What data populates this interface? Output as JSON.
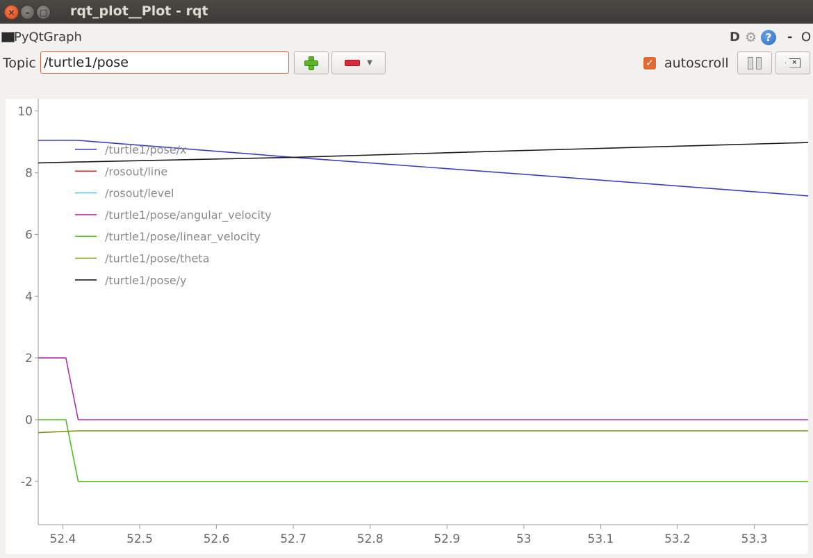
{
  "window": {
    "title": "rqt_plot__Plot - rqt",
    "close_glyph": "×",
    "min_glyph": "–",
    "max_glyph": "□"
  },
  "header": {
    "plugin_label": "PyQtGraph",
    "d_label": "D",
    "help_glyph": "?",
    "dash_label": "-",
    "o_label": "O"
  },
  "toolbar": {
    "topic_label": "Topic",
    "topic_value": "/turtle1/pose",
    "autoscroll_label": "autoscroll",
    "autoscroll_checked": true,
    "check_glyph": "✓",
    "clear_glyph": "×"
  },
  "chart_data": {
    "type": "line",
    "xlim": [
      52.368,
      53.37
    ],
    "ylim": [
      -3.4,
      10.4
    ],
    "x_ticks": [
      52.4,
      52.5,
      52.6,
      52.7,
      52.8,
      52.9,
      53,
      53.1,
      53.2,
      53.3
    ],
    "x_tick_labels": [
      "52.4",
      "52.5",
      "52.6",
      "52.7",
      "52.8",
      "52.9",
      "53",
      "53.1",
      "53.2",
      "53.3"
    ],
    "y_ticks": [
      10,
      8,
      6,
      4,
      2,
      0,
      -2
    ],
    "y_tick_labels": [
      "10",
      "8",
      "6",
      "4",
      "2",
      "0",
      "-2"
    ],
    "grid": false,
    "legend_position": "top-left",
    "series": [
      {
        "name": "/turtle1/pose/x",
        "color": "#3a3ec0",
        "x": [
          52.368,
          52.42,
          52.7,
          53.0,
          53.37
        ],
        "y": [
          9.05,
          9.05,
          8.5,
          7.95,
          7.25
        ]
      },
      {
        "name": "/rosout/line",
        "color": "#d62b2b",
        "x": [],
        "y": []
      },
      {
        "name": "/rosout/level",
        "color": "#5cc8d8",
        "x": [],
        "y": []
      },
      {
        "name": "/turtle1/pose/angular_velocity",
        "color": "#b22fae",
        "x": [
          52.368,
          52.404,
          52.42,
          53.37
        ],
        "y": [
          2.0,
          2.0,
          0.0,
          0.0
        ]
      },
      {
        "name": "/turtle1/pose/linear_velocity",
        "color": "#4ebf1c",
        "x": [
          52.368,
          52.404,
          52.42,
          53.37
        ],
        "y": [
          0.0,
          0.0,
          -2.0,
          -2.0
        ]
      },
      {
        "name": "/turtle1/pose/theta",
        "color": "#858a10",
        "x": [
          52.368,
          52.42,
          53.37
        ],
        "y": [
          -0.42,
          -0.36,
          -0.36
        ]
      },
      {
        "name": "/turtle1/pose/y",
        "color": "#1a1a1a",
        "x": [
          52.368,
          52.42,
          52.7,
          53.0,
          53.37
        ],
        "y": [
          8.32,
          8.35,
          8.5,
          8.72,
          8.98
        ]
      }
    ]
  }
}
